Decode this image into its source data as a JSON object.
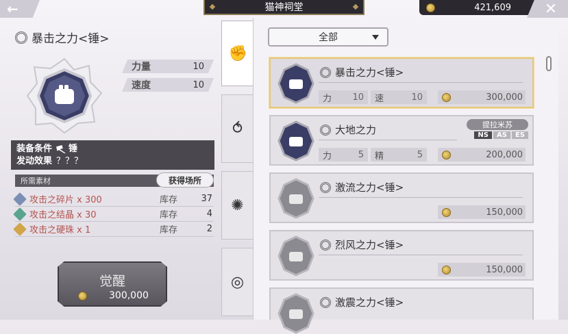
{
  "header": {
    "back_icon": "back-arrow-icon",
    "title": "猫神祠堂",
    "currency_value": "421,609",
    "close_icon": "close-icon"
  },
  "detail": {
    "title": "暴击之力<锤>",
    "stats": [
      {
        "label": "力量",
        "value": "10"
      },
      {
        "label": "速度",
        "value": "10"
      }
    ],
    "equip_condition_label": "装备条件",
    "equip_condition_value": "锤",
    "effect_label": "发动效果",
    "effect_value": "？？？",
    "materials_header": "所需素材",
    "acquire_button": "获得场所",
    "materials": [
      {
        "name": "攻击之碎片 x 300",
        "stock_label": "库存",
        "qty": "37",
        "color": "#7b8fb5"
      },
      {
        "name": "攻击之结晶 x 30",
        "stock_label": "库存",
        "qty": "4",
        "color": "#5aa48f"
      },
      {
        "name": "攻击之硬珠 x 1",
        "stock_label": "库存",
        "qty": "2",
        "color": "#d1a64a"
      }
    ],
    "awaken_label": "觉醒",
    "awaken_cost": "300,000"
  },
  "tabs": [
    {
      "icon": "fist-icon",
      "glyph": "✊"
    },
    {
      "icon": "swirl-plus-icon",
      "glyph": "⥀"
    },
    {
      "icon": "star-burst-icon",
      "glyph": "✺"
    },
    {
      "icon": "spiral-icon",
      "glyph": "◎"
    }
  ],
  "filter": {
    "selected": "全部"
  },
  "list": [
    {
      "name": "暴击之力<锤>",
      "stat1_label": "力",
      "stat1": "10",
      "stat2_label": "速",
      "stat2": "10",
      "price": "300,000",
      "selected": true,
      "gem": "dark"
    },
    {
      "name": "大地之力",
      "stat1_label": "力",
      "stat1": "5",
      "stat2_label": "精",
      "stat2": "5",
      "price": "200,000",
      "selected": false,
      "gem": "dark",
      "badge": "提拉米苏",
      "tags": [
        "NS",
        "AS",
        "ES"
      ]
    },
    {
      "name": "激流之力<锤>",
      "price": "150,000",
      "selected": false,
      "gem": "grey"
    },
    {
      "name": "烈风之力<锤>",
      "price": "150,000",
      "selected": false,
      "gem": "grey"
    },
    {
      "name": "激震之力<锤>",
      "price": "",
      "selected": false,
      "gem": "grey"
    }
  ]
}
